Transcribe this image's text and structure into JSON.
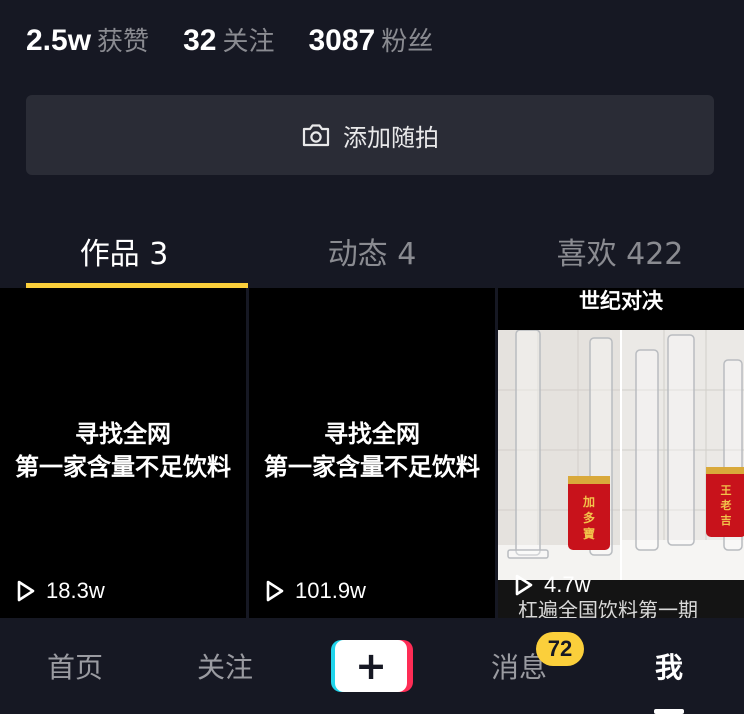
{
  "stats": [
    {
      "num": "2.5w",
      "label": "获赞"
    },
    {
      "num": "32",
      "label": "关注"
    },
    {
      "num": "3087",
      "label": "粉丝"
    }
  ],
  "snap": {
    "label": "添加随拍",
    "icon": "camera-icon"
  },
  "tabs": [
    {
      "label": "作品 3",
      "active": true
    },
    {
      "label": "动态 4",
      "active": false
    },
    {
      "label": "喜欢 422",
      "active": false
    }
  ],
  "videos": [
    {
      "line1": "寻找全网",
      "line2": "第一家含量不足饮料",
      "views": "18.3w"
    },
    {
      "line1": "寻找全网",
      "line2": "第一家含量不足饮料",
      "views": "101.9w"
    },
    {
      "top_text": "世纪对决",
      "views": "4.7w",
      "caption": "杠遍全国饮料第一期",
      "can_left_text": "加多宝",
      "can_right_text": "王老吉"
    }
  ],
  "nav": {
    "home": "首页",
    "follow": "关注",
    "plus": "+",
    "messages": "消息",
    "messages_badge": "72",
    "me": "我"
  },
  "colors": {
    "background": "#161823",
    "accent": "#fbcf3b",
    "brand_cyan": "#20d5ec",
    "brand_red": "#fe2c55"
  }
}
